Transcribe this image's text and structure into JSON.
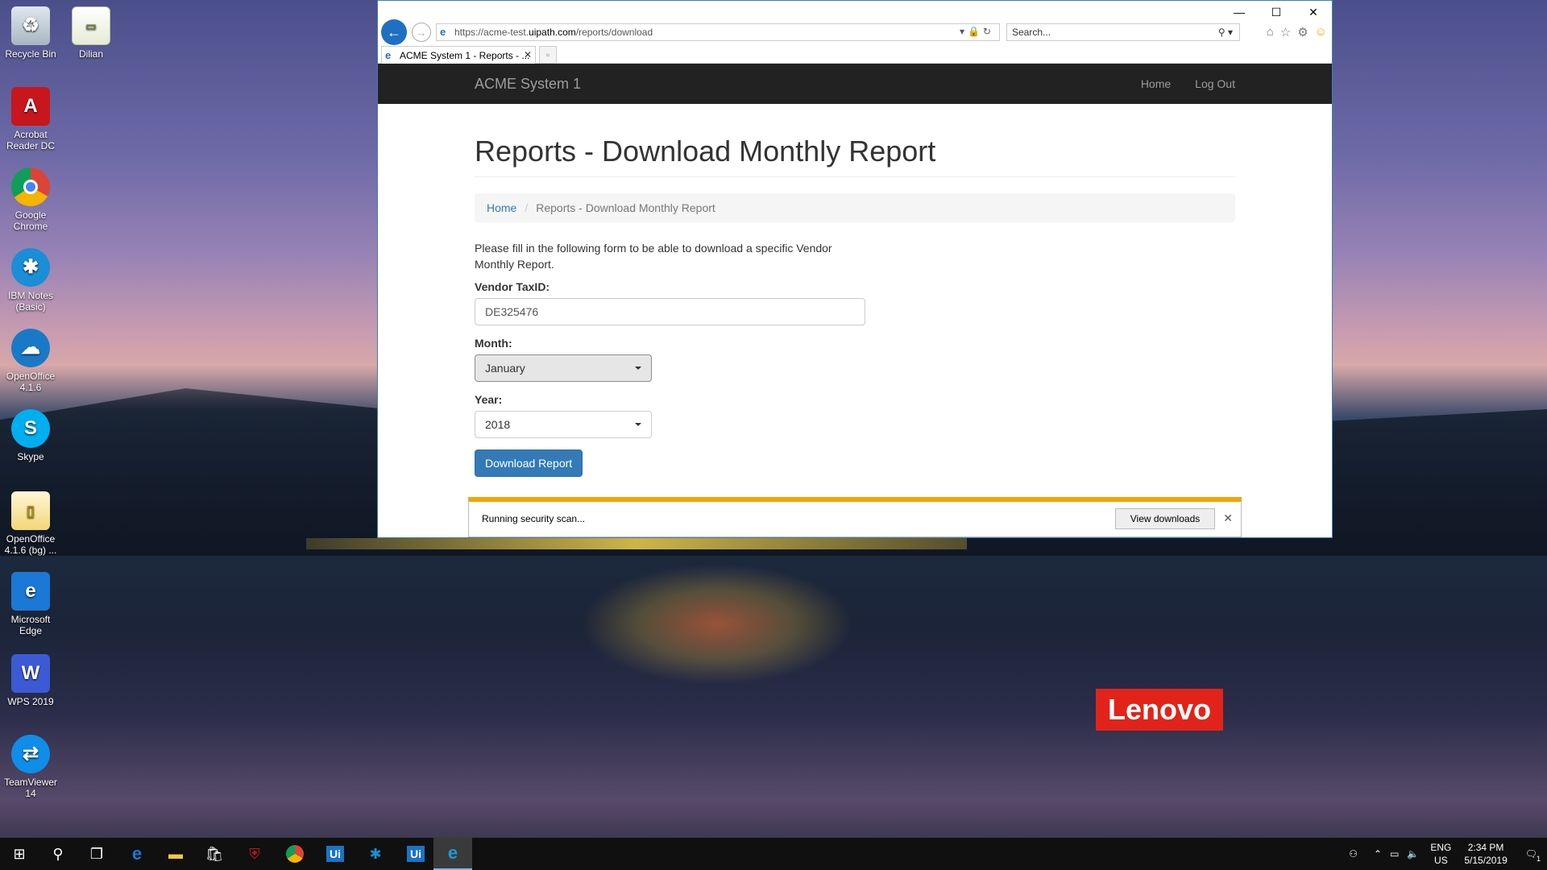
{
  "desktop": {
    "icons": [
      {
        "label": "Recycle Bin"
      },
      {
        "label": "Dilian"
      },
      {
        "label": "Acrobat Reader DC"
      },
      {
        "label": "Google Chrome"
      },
      {
        "label": "IBM Notes (Basic)"
      },
      {
        "label": "OpenOffice 4.1.6"
      },
      {
        "label": "Skype"
      },
      {
        "label": "OpenOffice 4.1.6 (bg) ..."
      },
      {
        "label": "Microsoft Edge"
      },
      {
        "label": "WPS 2019"
      },
      {
        "label": "TeamViewer 14"
      }
    ],
    "brand": "Lenovo"
  },
  "browser": {
    "url_prefix": "https://acme-test.",
    "url_host": "uipath.com",
    "url_path": "/reports/download",
    "search_placeholder": "Search...",
    "tab_title": "ACME System 1 - Reports - ...",
    "accent": "#1f6fc2"
  },
  "page": {
    "navbar": {
      "brand": "ACME System 1",
      "links": [
        "Home",
        "Log Out"
      ]
    },
    "title": "Reports - Download Monthly Report",
    "breadcrumb": {
      "home": "Home",
      "current": "Reports - Download Monthly Report"
    },
    "intro": "Please fill in the following form to be able to download a specific Vendor Monthly Report.",
    "form": {
      "taxid_label": "Vendor TaxID:",
      "taxid_value": "DE325476",
      "month_label": "Month:",
      "month_value": "January",
      "year_label": "Year:",
      "year_value": "2018",
      "submit": "Download Report"
    }
  },
  "notification": {
    "message": "Running security scan...",
    "action": "View downloads"
  },
  "taskbar": {
    "time": "2:34 PM",
    "date": "5/15/2019",
    "lang": "ENG",
    "region": "US",
    "notification_count": "1"
  }
}
